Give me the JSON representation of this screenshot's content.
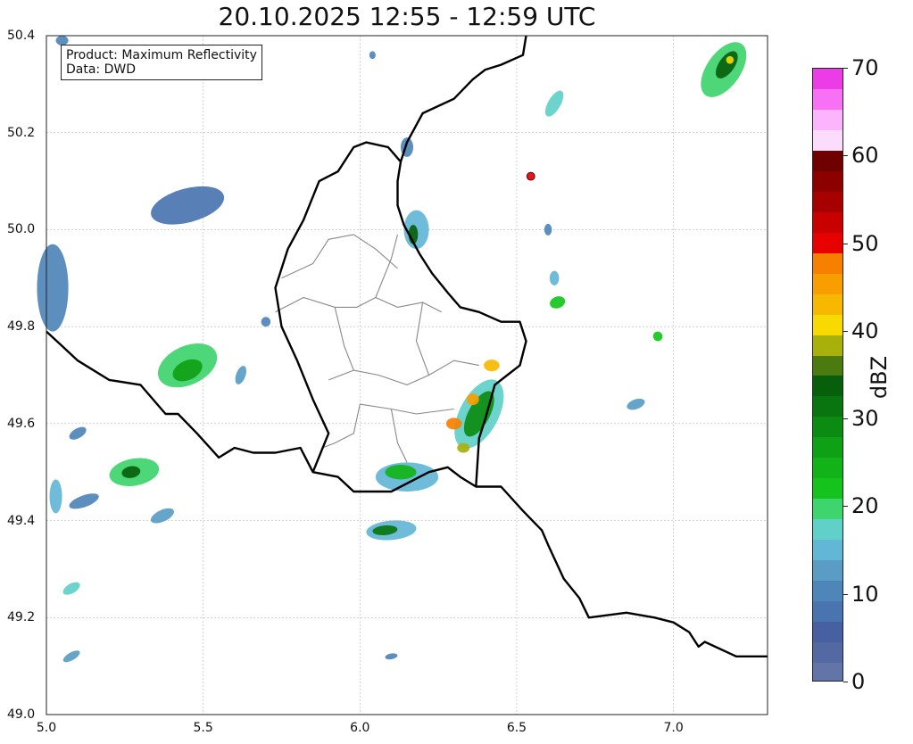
{
  "title": "20.10.2025 12:55 - 12:59 UTC",
  "info": {
    "product": "Product: Maximum Reflectivity",
    "data": "Data: DWD"
  },
  "axes": {
    "x_ticks": [
      "5.0",
      "5.5",
      "6.0",
      "6.5",
      "7.0"
    ],
    "x_values": [
      5.0,
      5.5,
      6.0,
      6.5,
      7.0
    ],
    "y_ticks": [
      "49.0",
      "49.2",
      "49.4",
      "49.6",
      "49.8",
      "50.0",
      "50.2",
      "50.4"
    ],
    "y_values": [
      49.0,
      49.2,
      49.4,
      49.6,
      49.8,
      50.0,
      50.2,
      50.4
    ],
    "x_range": [
      5.0,
      7.3
    ],
    "y_range": [
      49.0,
      50.4
    ],
    "grid": true
  },
  "colorbar": {
    "label": "dBZ",
    "ticks": [
      "0",
      "10",
      "20",
      "30",
      "40",
      "50",
      "60",
      "70"
    ],
    "tick_values": [
      0,
      10,
      20,
      30,
      40,
      50,
      60,
      70
    ],
    "range": [
      0,
      70
    ],
    "colors": [
      "#6274a8",
      "#5468a3",
      "#4660a2",
      "#4a74b0",
      "#4f86b9",
      "#5a9cc6",
      "#62b6d6",
      "#60d0c8",
      "#3ed46e",
      "#14c41c",
      "#12b318",
      "#0fa115",
      "#0c8b12",
      "#097510",
      "#075f0c",
      "#4a7a10",
      "#a8b00a",
      "#f8da00",
      "#f8b800",
      "#f89e00",
      "#f88000",
      "#e80000",
      "#c80000",
      "#a80000",
      "#8c0000",
      "#700000",
      "#fcdcfc",
      "#fcb4fc",
      "#f870f4",
      "#ec3ce8"
    ]
  },
  "marker": {
    "lon": 6.545,
    "lat": 50.11,
    "color": "#e8141c"
  },
  "radar_cells": [
    {
      "lon": 5.45,
      "lat": 50.05,
      "rx": 0.12,
      "ry": 0.035,
      "rot": -15,
      "level": 3
    },
    {
      "lon": 5.02,
      "lat": 49.88,
      "rx": 0.05,
      "ry": 0.09,
      "rot": 0,
      "level": 4
    },
    {
      "lon": 5.45,
      "lat": 49.72,
      "rx": 0.1,
      "ry": 0.04,
      "rot": -25,
      "level": 8
    },
    {
      "lon": 5.45,
      "lat": 49.71,
      "rx": 0.05,
      "ry": 0.02,
      "rot": -25,
      "level": 11
    },
    {
      "lon": 5.28,
      "lat": 49.5,
      "rx": 0.08,
      "ry": 0.028,
      "rot": -10,
      "level": 8
    },
    {
      "lon": 5.27,
      "lat": 49.5,
      "rx": 0.03,
      "ry": 0.012,
      "rot": -10,
      "level": 14
    },
    {
      "lon": 5.12,
      "lat": 49.44,
      "rx": 0.05,
      "ry": 0.012,
      "rot": -20,
      "level": 4
    },
    {
      "lon": 5.03,
      "lat": 49.45,
      "rx": 0.02,
      "ry": 0.035,
      "rot": 0,
      "level": 6
    },
    {
      "lon": 5.37,
      "lat": 49.41,
      "rx": 0.04,
      "ry": 0.012,
      "rot": -25,
      "level": 5
    },
    {
      "lon": 5.08,
      "lat": 49.26,
      "rx": 0.03,
      "ry": 0.01,
      "rot": -30,
      "level": 7
    },
    {
      "lon": 5.08,
      "lat": 49.12,
      "rx": 0.03,
      "ry": 0.008,
      "rot": -30,
      "level": 5
    },
    {
      "lon": 5.1,
      "lat": 49.58,
      "rx": 0.03,
      "ry": 0.01,
      "rot": -30,
      "level": 4
    },
    {
      "lon": 6.15,
      "lat": 49.49,
      "rx": 0.1,
      "ry": 0.03,
      "rot": 0,
      "level": 6
    },
    {
      "lon": 6.13,
      "lat": 49.5,
      "rx": 0.05,
      "ry": 0.015,
      "rot": 0,
      "level": 10
    },
    {
      "lon": 6.1,
      "lat": 49.38,
      "rx": 0.08,
      "ry": 0.02,
      "rot": -5,
      "level": 6
    },
    {
      "lon": 6.08,
      "lat": 49.38,
      "rx": 0.04,
      "ry": 0.01,
      "rot": -5,
      "level": 13
    },
    {
      "lon": 6.18,
      "lat": 50.0,
      "rx": 0.04,
      "ry": 0.04,
      "rot": 0,
      "level": 6
    },
    {
      "lon": 6.17,
      "lat": 49.99,
      "rx": 0.015,
      "ry": 0.02,
      "rot": 0,
      "level": 14
    },
    {
      "lon": 6.38,
      "lat": 49.62,
      "rx": 0.12,
      "ry": 0.04,
      "rot": -62,
      "level": 7
    },
    {
      "lon": 6.38,
      "lat": 49.62,
      "rx": 0.08,
      "ry": 0.022,
      "rot": -62,
      "level": 12
    },
    {
      "lon": 6.42,
      "lat": 49.72,
      "rx": 0.025,
      "ry": 0.012,
      "rot": 0,
      "level": 18
    },
    {
      "lon": 6.36,
      "lat": 49.65,
      "rx": 0.02,
      "ry": 0.012,
      "rot": 0,
      "level": 19
    },
    {
      "lon": 6.3,
      "lat": 49.6,
      "rx": 0.025,
      "ry": 0.012,
      "rot": 0,
      "level": 20
    },
    {
      "lon": 6.33,
      "lat": 49.55,
      "rx": 0.02,
      "ry": 0.01,
      "rot": 0,
      "level": 16
    },
    {
      "lon": 7.16,
      "lat": 50.33,
      "rx": 0.1,
      "ry": 0.035,
      "rot": -55,
      "level": 8
    },
    {
      "lon": 7.17,
      "lat": 50.34,
      "rx": 0.05,
      "ry": 0.016,
      "rot": -55,
      "level": 14
    },
    {
      "lon": 7.18,
      "lat": 50.35,
      "rx": 0.012,
      "ry": 0.008,
      "rot": 0,
      "level": 17
    },
    {
      "lon": 6.62,
      "lat": 50.26,
      "rx": 0.02,
      "ry": 0.03,
      "rot": 30,
      "level": 7
    },
    {
      "lon": 6.63,
      "lat": 49.85,
      "rx": 0.025,
      "ry": 0.012,
      "rot": -20,
      "level": 9
    },
    {
      "lon": 6.62,
      "lat": 49.9,
      "rx": 0.015,
      "ry": 0.015,
      "rot": 0,
      "level": 6
    },
    {
      "lon": 6.6,
      "lat": 50.0,
      "rx": 0.012,
      "ry": 0.012,
      "rot": 0,
      "level": 4
    },
    {
      "lon": 6.88,
      "lat": 49.64,
      "rx": 0.03,
      "ry": 0.01,
      "rot": -20,
      "level": 5
    },
    {
      "lon": 6.95,
      "lat": 49.78,
      "rx": 0.015,
      "ry": 0.01,
      "rot": -20,
      "level": 9
    },
    {
      "lon": 6.15,
      "lat": 50.17,
      "rx": 0.02,
      "ry": 0.02,
      "rot": 0,
      "level": 4
    },
    {
      "lon": 5.62,
      "lat": 49.7,
      "rx": 0.015,
      "ry": 0.02,
      "rot": 20,
      "level": 5
    },
    {
      "lon": 5.7,
      "lat": 49.81,
      "rx": 0.015,
      "ry": 0.01,
      "rot": 0,
      "level": 4
    },
    {
      "lon": 6.1,
      "lat": 49.12,
      "rx": 0.02,
      "ry": 0.006,
      "rot": -10,
      "level": 4
    },
    {
      "lon": 6.04,
      "lat": 50.36,
      "rx": 0.01,
      "ry": 0.008,
      "rot": 0,
      "level": 4
    },
    {
      "lon": 5.05,
      "lat": 50.39,
      "rx": 0.02,
      "ry": 0.01,
      "rot": 0,
      "level": 4
    }
  ],
  "borders": {
    "national": [
      [
        [
          5.0,
          49.79
        ],
        [
          5.05,
          49.76
        ],
        [
          5.1,
          49.73
        ],
        [
          5.2,
          49.69
        ],
        [
          5.3,
          49.68
        ],
        [
          5.38,
          49.62
        ],
        [
          5.42,
          49.62
        ],
        [
          5.48,
          49.58
        ],
        [
          5.55,
          49.53
        ],
        [
          5.6,
          49.55
        ],
        [
          5.66,
          49.54
        ],
        [
          5.73,
          49.54
        ],
        [
          5.81,
          49.55
        ],
        [
          5.85,
          49.5
        ],
        [
          5.93,
          49.49
        ],
        [
          5.98,
          49.46
        ],
        [
          6.1,
          49.46
        ],
        [
          6.22,
          49.5
        ],
        [
          6.28,
          49.51
        ],
        [
          6.32,
          49.49
        ],
        [
          6.37,
          49.47
        ],
        [
          6.45,
          49.47
        ],
        [
          6.52,
          49.42
        ],
        [
          6.58,
          49.38
        ],
        [
          6.6,
          49.35
        ],
        [
          6.65,
          49.28
        ],
        [
          6.7,
          49.24
        ],
        [
          6.73,
          49.2
        ],
        [
          6.85,
          49.21
        ],
        [
          6.94,
          49.2
        ],
        [
          7.0,
          49.19
        ],
        [
          7.05,
          49.17
        ],
        [
          7.08,
          49.14
        ],
        [
          7.1,
          49.15
        ],
        [
          7.2,
          49.12
        ],
        [
          7.3,
          49.12
        ]
      ],
      [
        [
          6.53,
          50.4
        ],
        [
          6.52,
          50.36
        ],
        [
          6.45,
          50.34
        ],
        [
          6.4,
          50.33
        ],
        [
          6.36,
          50.31
        ],
        [
          6.3,
          50.27
        ],
        [
          6.2,
          50.24
        ],
        [
          6.15,
          50.18
        ],
        [
          6.13,
          50.14
        ],
        [
          6.12,
          50.1
        ],
        [
          6.12,
          50.05
        ],
        [
          6.14,
          50.01
        ],
        [
          6.19,
          49.95
        ],
        [
          6.23,
          49.91
        ],
        [
          6.28,
          49.87
        ],
        [
          6.32,
          49.84
        ],
        [
          6.38,
          49.83
        ],
        [
          6.45,
          49.81
        ],
        [
          6.51,
          49.81
        ],
        [
          6.53,
          49.77
        ],
        [
          6.51,
          49.72
        ],
        [
          6.47,
          49.7
        ],
        [
          6.43,
          49.68
        ],
        [
          6.4,
          49.61
        ],
        [
          6.38,
          49.57
        ],
        [
          6.37,
          49.47
        ]
      ],
      [
        [
          6.13,
          50.14
        ],
        [
          6.09,
          50.17
        ],
        [
          6.02,
          50.18
        ],
        [
          5.98,
          50.17
        ],
        [
          5.93,
          50.12
        ],
        [
          5.87,
          50.1
        ],
        [
          5.82,
          50.02
        ],
        [
          5.77,
          49.96
        ],
        [
          5.73,
          49.88
        ],
        [
          5.75,
          49.8
        ],
        [
          5.8,
          49.73
        ],
        [
          5.85,
          49.65
        ],
        [
          5.9,
          49.58
        ],
        [
          5.85,
          49.5
        ]
      ]
    ],
    "regional": [
      [
        [
          5.98,
          49.99
        ],
        [
          5.9,
          49.98
        ],
        [
          5.85,
          49.93
        ],
        [
          5.75,
          49.9
        ]
      ],
      [
        [
          5.98,
          49.99
        ],
        [
          6.05,
          49.96
        ],
        [
          6.12,
          49.92
        ]
      ],
      [
        [
          5.73,
          49.83
        ],
        [
          5.82,
          49.86
        ],
        [
          5.92,
          49.84
        ],
        [
          5.99,
          49.84
        ],
        [
          6.05,
          49.86
        ],
        [
          6.12,
          49.84
        ],
        [
          6.2,
          49.85
        ],
        [
          6.26,
          49.83
        ]
      ],
      [
        [
          5.92,
          49.84
        ],
        [
          5.95,
          49.76
        ],
        [
          5.98,
          49.71
        ],
        [
          5.9,
          49.69
        ]
      ],
      [
        [
          5.98,
          49.71
        ],
        [
          6.06,
          49.7
        ],
        [
          6.15,
          49.68
        ],
        [
          6.22,
          49.7
        ],
        [
          6.3,
          49.73
        ],
        [
          6.38,
          49.72
        ]
      ],
      [
        [
          6.0,
          49.64
        ],
        [
          6.1,
          49.63
        ],
        [
          6.18,
          49.62
        ],
        [
          6.3,
          49.63
        ]
      ],
      [
        [
          6.0,
          49.64
        ],
        [
          5.98,
          49.58
        ],
        [
          5.92,
          49.56
        ],
        [
          5.88,
          49.55
        ]
      ],
      [
        [
          6.1,
          49.63
        ],
        [
          6.12,
          49.56
        ],
        [
          6.15,
          49.52
        ]
      ],
      [
        [
          6.05,
          49.86
        ],
        [
          6.1,
          49.94
        ],
        [
          6.12,
          49.99
        ]
      ],
      [
        [
          6.2,
          49.85
        ],
        [
          6.18,
          49.77
        ],
        [
          6.22,
          49.7
        ]
      ]
    ]
  }
}
